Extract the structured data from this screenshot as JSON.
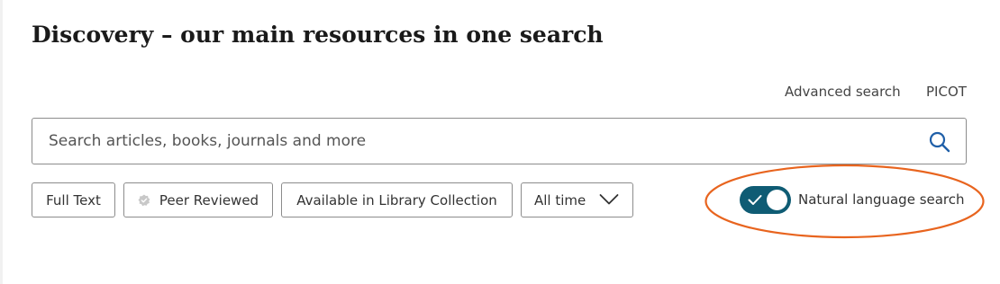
{
  "header": {
    "title": "Discovery – our main resources in one search"
  },
  "links": {
    "advanced_search": "Advanced search",
    "picot": "PICOT"
  },
  "search": {
    "placeholder": "Search articles, books, journals and more",
    "value": "",
    "icon": "search-icon"
  },
  "filters": {
    "full_text": "Full Text",
    "peer_reviewed": "Peer Reviewed",
    "peer_reviewed_icon": "verified-badge-icon",
    "library_collection": "Available in Library Collection",
    "date_range": {
      "selected": "All time",
      "icon": "chevron-down-icon"
    }
  },
  "natural_language": {
    "label": "Natural language search",
    "enabled": true
  },
  "colors": {
    "toggle_on": "#0f5c74",
    "search_icon": "#1f5fa8",
    "annotation": "#e8641e"
  }
}
